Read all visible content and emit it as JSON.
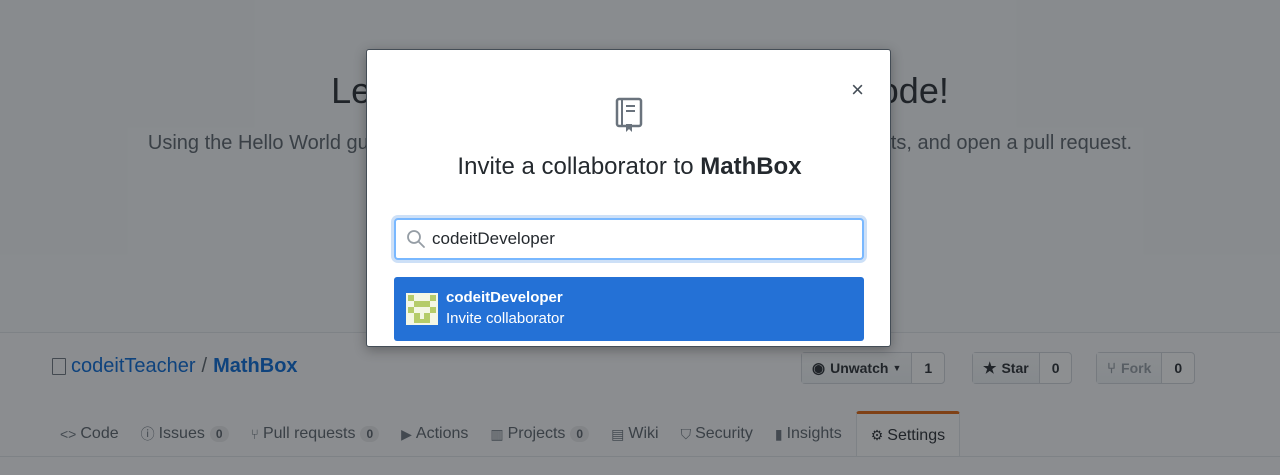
{
  "hero": {
    "title": "Let’s get started by adding some code!",
    "subtitle": "Using the Hello World guide, you’ll create a repository, start a branch, write comments, and open a pull request."
  },
  "repo": {
    "owner": "codeitTeacher",
    "separator": "/",
    "name": "MathBox"
  },
  "actions": {
    "unwatch_label": "Unwatch",
    "unwatch_count": "1",
    "star_label": "Star",
    "star_count": "0",
    "fork_label": "Fork",
    "fork_count": "0"
  },
  "tabs": [
    {
      "label": "Code",
      "icon": "code-icon"
    },
    {
      "label": "Issues",
      "icon": "issue-icon",
      "counter": "0"
    },
    {
      "label": "Pull requests",
      "icon": "pull-request-icon",
      "counter": "0"
    },
    {
      "label": "Actions",
      "icon": "play-icon"
    },
    {
      "label": "Projects",
      "icon": "project-icon",
      "counter": "0"
    },
    {
      "label": "Wiki",
      "icon": "book-icon"
    },
    {
      "label": "Security",
      "icon": "shield-icon"
    },
    {
      "label": "Insights",
      "icon": "graph-icon"
    },
    {
      "label": "Settings",
      "icon": "gear-icon",
      "selected": true
    }
  ],
  "modal": {
    "title_prefix": "Invite a collaborator to",
    "title_repo": "MathBox",
    "close_glyph": "×",
    "search_value": "codeitDeveloper",
    "suggestion": {
      "username": "codeitDeveloper",
      "action": "Invite collaborator"
    }
  },
  "colors": {
    "accent": "#2471d6",
    "link": "#0366d6",
    "selected_tab_border": "#e36209"
  }
}
